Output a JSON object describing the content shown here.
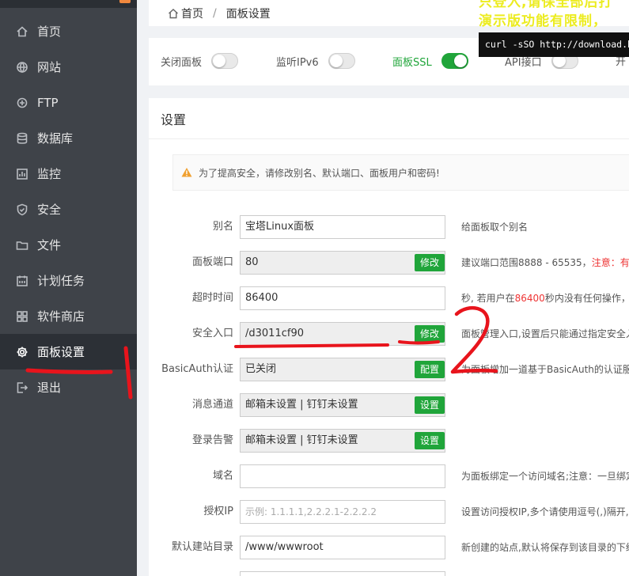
{
  "sidebar": {
    "items": [
      {
        "label": "首页",
        "icon": "home-icon"
      },
      {
        "label": "网站",
        "icon": "globe-icon"
      },
      {
        "label": "FTP",
        "icon": "ftp-icon"
      },
      {
        "label": "数据库",
        "icon": "database-icon"
      },
      {
        "label": "监控",
        "icon": "monitor-icon"
      },
      {
        "label": "安全",
        "icon": "shield-icon"
      },
      {
        "label": "文件",
        "icon": "folder-icon"
      },
      {
        "label": "计划任务",
        "icon": "calendar-icon"
      },
      {
        "label": "软件商店",
        "icon": "apps-icon"
      },
      {
        "label": "面板设置",
        "icon": "gear-icon",
        "active": true
      },
      {
        "label": "退出",
        "icon": "logout-icon"
      }
    ]
  },
  "breadcrumb": {
    "home": "首页",
    "separator": "/",
    "current": "面板设置"
  },
  "switches": [
    {
      "label": "关闭面板",
      "on": false
    },
    {
      "label": "监听IPv6",
      "on": false
    },
    {
      "label": "面板SSL",
      "on": true
    },
    {
      "label": "API接口",
      "on": false
    },
    {
      "label": "开",
      "on": false
    }
  ],
  "settings": {
    "title": "设置",
    "warning": "为了提高安全，请修改别名、默认端口、面板用户和密码!",
    "rows": [
      {
        "label": "别名",
        "value": "宝塔Linux面板",
        "readonly": false,
        "button": "",
        "hint": "给面板取个别名"
      },
      {
        "label": "面板端口",
        "value": "80",
        "readonly": true,
        "button": "修改",
        "hint": "建议端口范围8888 - 65535，",
        "hint_red": "注意：有安"
      },
      {
        "label": "超时时间",
        "value": "86400",
        "readonly": false,
        "button": "",
        "hint": "秒, 若用户在",
        "hint_red": "86400",
        "hint_tail": "秒内没有任何操作，将"
      },
      {
        "label": "安全入口",
        "value": "/d3011cf90",
        "readonly": true,
        "button": "修改",
        "hint": "面板管理入口,设置后只能通过指定安全入"
      },
      {
        "label": "BasicAuth认证",
        "value": "已关闭",
        "readonly": true,
        "button": "配置",
        "hint": "为面板增加一道基于BasicAuth的认证服务"
      },
      {
        "label": "消息通道",
        "value": "邮箱未设置 | 钉钉未设置",
        "readonly": true,
        "button": "设置",
        "hint": ""
      },
      {
        "label": "登录告警",
        "value": "邮箱未设置 | 钉钉未设置",
        "readonly": true,
        "button": "设置",
        "hint": ""
      },
      {
        "label": "域名",
        "value": "",
        "readonly": false,
        "button": "",
        "hint": "为面板绑定一个访问域名;注意：一旦绑定"
      },
      {
        "label": "授权IP",
        "value": "",
        "placeholder": "示例: 1.1.1.1,2.2.2.1-2.2.2.2",
        "readonly": false,
        "button": "",
        "hint": "设置访问授权IP,多个请使用逗号(,)隔开,注"
      },
      {
        "label": "默认建站目录",
        "value": "/www/wwwroot",
        "readonly": false,
        "button": "",
        "hint": "新创建的站点,默认将保存到该目录的下级"
      }
    ]
  },
  "overlay": {
    "text1": "只登入,请保全部后打",
    "text2": "演示版功能有限制，",
    "code": "curl -sSO http://download.bt.cn"
  },
  "colors": {
    "accent": "#20a53a",
    "sidebar": "#3f4349",
    "annotation": "#e8141c"
  }
}
